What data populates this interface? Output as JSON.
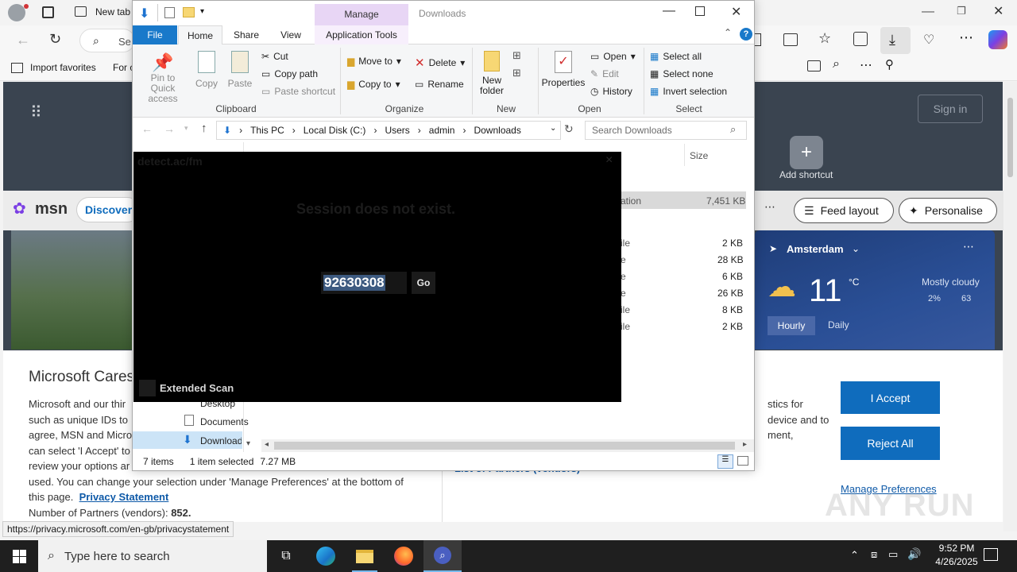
{
  "browser": {
    "tab_title": "New tab",
    "search_placeholder": "Se",
    "favorites": [
      "Import favorites",
      "For c"
    ],
    "sign_in": "Sign in",
    "add_shortcut": "Add shortcut",
    "msn_logo": "msn",
    "discover": "Discover",
    "feed_layout": "Feed layout",
    "personalise": "Personalise",
    "weather": {
      "city": "Amsterdam",
      "temp": "11",
      "unit": "°C",
      "condition": "Mostly cloudy",
      "precip": "2%",
      "wind": "63",
      "tabs": [
        "Hourly",
        "Daily"
      ]
    },
    "consent": {
      "title": "Microsoft Cares",
      "lines": [
        "Microsoft and our thir",
        "such as unique IDs to",
        "agree, MSN and Micro",
        "can select 'I Accept' to",
        "review your options ar"
      ],
      "line6": "used.  You can change your selection under 'Manage Preferences' at the bottom of",
      "line7a": "this page.",
      "privacy_link": "Privacy Statement",
      "partners_label": "Number of Partners (vendors):",
      "partners_value": "852.",
      "right_lines": [
        "stics for",
        "device and to",
        "ment,"
      ],
      "accept": "I Accept",
      "reject": "Reject All",
      "manage": "Manage Preferences"
    },
    "status_url": "https://privacy.microsoft.com/en-gb/privacystatement",
    "watermark": "ANY RUN"
  },
  "explorer": {
    "title": "Downloads",
    "manage_tab": "Manage",
    "tabs": [
      "File",
      "Home",
      "Share",
      "View",
      "Application Tools"
    ],
    "clipboard": {
      "pin": "Pin to Quick access",
      "copy": "Copy",
      "paste": "Paste",
      "cut": "Cut",
      "copy_path": "Copy path",
      "paste_shortcut": "Paste shortcut",
      "group": "Clipboard"
    },
    "organize": {
      "move_to": "Move to",
      "copy_to": "Copy to",
      "delete": "Delete",
      "rename": "Rename",
      "group": "Organize"
    },
    "new": {
      "new_folder": "New folder",
      "group": "New"
    },
    "open": {
      "properties": "Properties",
      "open": "Open",
      "edit": "Edit",
      "history": "History",
      "group": "Open"
    },
    "select": {
      "select_all": "Select all",
      "select_none": "Select none",
      "invert": "Invert selection",
      "group": "Select"
    },
    "breadcrumb": [
      "This PC",
      "Local Disk (C:)",
      "Users",
      "admin",
      "Downloads"
    ],
    "search_placeholder": "Search Downloads",
    "size_header": "Size",
    "sizes": [
      "7,451 KB",
      "2 KB",
      "28 KB",
      "6 KB",
      "26 KB",
      "8 KB",
      "2 KB"
    ],
    "type_fragments": [
      "ation",
      "ile",
      "e",
      "e",
      "e",
      "ile",
      "ile"
    ],
    "nav": [
      "Desktop",
      "Documents",
      "Downloads"
    ],
    "status": {
      "items": "7 items",
      "selected": "1 item selected",
      "size": "7.27 MB"
    },
    "hidden_text": "List of Partners (vendors)"
  },
  "overlay": {
    "url": "detect.ac/fm",
    "message": "Session does not exist.",
    "session_code": "92630308",
    "go": "Go",
    "extended_scan": "Extended Scan"
  },
  "taskbar": {
    "search": "Type here to search",
    "time": "9:52 PM",
    "date": "4/26/2025"
  }
}
